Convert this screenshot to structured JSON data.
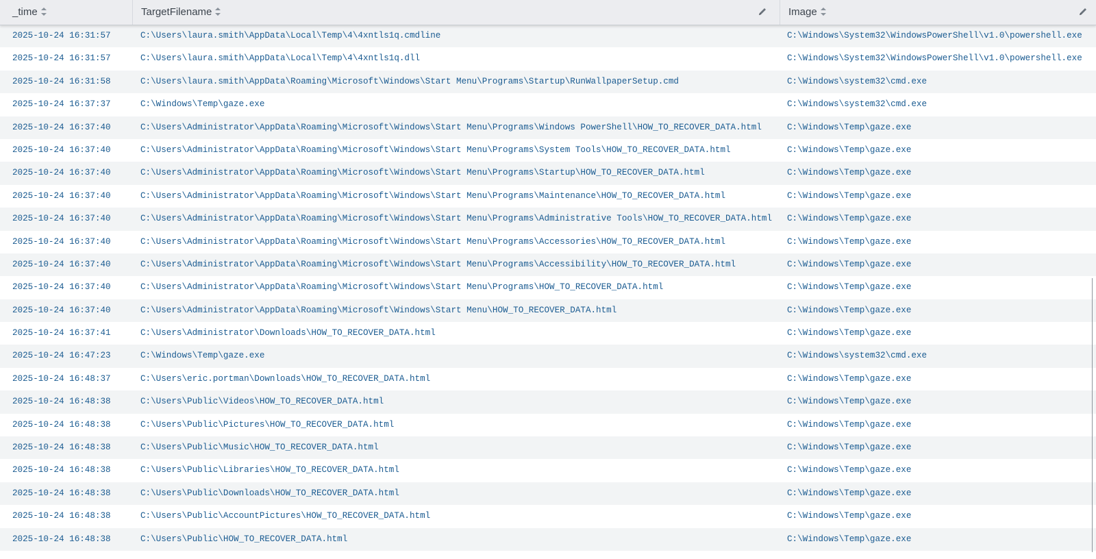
{
  "table": {
    "columns": {
      "time": "_time",
      "target": "TargetFilename",
      "image": "Image"
    },
    "rows": [
      {
        "time": "2025-10-24 16:31:57",
        "target": "C:\\Users\\laura.smith\\AppData\\Local\\Temp\\4\\4xntls1q.cmdline",
        "image": "C:\\Windows\\System32\\WindowsPowerShell\\v1.0\\powershell.exe"
      },
      {
        "time": "2025-10-24 16:31:57",
        "target": "C:\\Users\\laura.smith\\AppData\\Local\\Temp\\4\\4xntls1q.dll",
        "image": "C:\\Windows\\System32\\WindowsPowerShell\\v1.0\\powershell.exe"
      },
      {
        "time": "2025-10-24 16:31:58",
        "target": "C:\\Users\\laura.smith\\AppData\\Roaming\\Microsoft\\Windows\\Start Menu\\Programs\\Startup\\RunWallpaperSetup.cmd",
        "image": "C:\\Windows\\system32\\cmd.exe"
      },
      {
        "time": "2025-10-24 16:37:37",
        "target": "C:\\Windows\\Temp\\gaze.exe",
        "image": "C:\\Windows\\system32\\cmd.exe"
      },
      {
        "time": "2025-10-24 16:37:40",
        "target": "C:\\Users\\Administrator\\AppData\\Roaming\\Microsoft\\Windows\\Start Menu\\Programs\\Windows PowerShell\\HOW_TO_RECOVER_DATA.html",
        "image": "C:\\Windows\\Temp\\gaze.exe"
      },
      {
        "time": "2025-10-24 16:37:40",
        "target": "C:\\Users\\Administrator\\AppData\\Roaming\\Microsoft\\Windows\\Start Menu\\Programs\\System Tools\\HOW_TO_RECOVER_DATA.html",
        "image": "C:\\Windows\\Temp\\gaze.exe"
      },
      {
        "time": "2025-10-24 16:37:40",
        "target": "C:\\Users\\Administrator\\AppData\\Roaming\\Microsoft\\Windows\\Start Menu\\Programs\\Startup\\HOW_TO_RECOVER_DATA.html",
        "image": "C:\\Windows\\Temp\\gaze.exe"
      },
      {
        "time": "2025-10-24 16:37:40",
        "target": "C:\\Users\\Administrator\\AppData\\Roaming\\Microsoft\\Windows\\Start Menu\\Programs\\Maintenance\\HOW_TO_RECOVER_DATA.html",
        "image": "C:\\Windows\\Temp\\gaze.exe"
      },
      {
        "time": "2025-10-24 16:37:40",
        "target": "C:\\Users\\Administrator\\AppData\\Roaming\\Microsoft\\Windows\\Start Menu\\Programs\\Administrative Tools\\HOW_TO_RECOVER_DATA.html",
        "image": "C:\\Windows\\Temp\\gaze.exe"
      },
      {
        "time": "2025-10-24 16:37:40",
        "target": "C:\\Users\\Administrator\\AppData\\Roaming\\Microsoft\\Windows\\Start Menu\\Programs\\Accessories\\HOW_TO_RECOVER_DATA.html",
        "image": "C:\\Windows\\Temp\\gaze.exe"
      },
      {
        "time": "2025-10-24 16:37:40",
        "target": "C:\\Users\\Administrator\\AppData\\Roaming\\Microsoft\\Windows\\Start Menu\\Programs\\Accessibility\\HOW_TO_RECOVER_DATA.html",
        "image": "C:\\Windows\\Temp\\gaze.exe"
      },
      {
        "time": "2025-10-24 16:37:40",
        "target": "C:\\Users\\Administrator\\AppData\\Roaming\\Microsoft\\Windows\\Start Menu\\Programs\\HOW_TO_RECOVER_DATA.html",
        "image": "C:\\Windows\\Temp\\gaze.exe"
      },
      {
        "time": "2025-10-24 16:37:40",
        "target": "C:\\Users\\Administrator\\AppData\\Roaming\\Microsoft\\Windows\\Start Menu\\HOW_TO_RECOVER_DATA.html",
        "image": "C:\\Windows\\Temp\\gaze.exe"
      },
      {
        "time": "2025-10-24 16:37:41",
        "target": "C:\\Users\\Administrator\\Downloads\\HOW_TO_RECOVER_DATA.html",
        "image": "C:\\Windows\\Temp\\gaze.exe"
      },
      {
        "time": "2025-10-24 16:47:23",
        "target": "C:\\Windows\\Temp\\gaze.exe",
        "image": "C:\\Windows\\system32\\cmd.exe"
      },
      {
        "time": "2025-10-24 16:48:37",
        "target": "C:\\Users\\eric.portman\\Downloads\\HOW_TO_RECOVER_DATA.html",
        "image": "C:\\Windows\\Temp\\gaze.exe"
      },
      {
        "time": "2025-10-24 16:48:38",
        "target": "C:\\Users\\Public\\Videos\\HOW_TO_RECOVER_DATA.html",
        "image": "C:\\Windows\\Temp\\gaze.exe"
      },
      {
        "time": "2025-10-24 16:48:38",
        "target": "C:\\Users\\Public\\Pictures\\HOW_TO_RECOVER_DATA.html",
        "image": "C:\\Windows\\Temp\\gaze.exe"
      },
      {
        "time": "2025-10-24 16:48:38",
        "target": "C:\\Users\\Public\\Music\\HOW_TO_RECOVER_DATA.html",
        "image": "C:\\Windows\\Temp\\gaze.exe"
      },
      {
        "time": "2025-10-24 16:48:38",
        "target": "C:\\Users\\Public\\Libraries\\HOW_TO_RECOVER_DATA.html",
        "image": "C:\\Windows\\Temp\\gaze.exe"
      },
      {
        "time": "2025-10-24 16:48:38",
        "target": "C:\\Users\\Public\\Downloads\\HOW_TO_RECOVER_DATA.html",
        "image": "C:\\Windows\\Temp\\gaze.exe"
      },
      {
        "time": "2025-10-24 16:48:38",
        "target": "C:\\Users\\Public\\AccountPictures\\HOW_TO_RECOVER_DATA.html",
        "image": "C:\\Windows\\Temp\\gaze.exe"
      },
      {
        "time": "2025-10-24 16:48:38",
        "target": "C:\\Users\\Public\\HOW_TO_RECOVER_DATA.html",
        "image": "C:\\Windows\\Temp\\gaze.exe"
      }
    ]
  },
  "icons": {
    "sort": "sort-icon",
    "edit": "pencil-icon"
  },
  "colors": {
    "link": "#1a5b91",
    "header_bg": "#ecedf0",
    "row_alt": "#f2f4f5"
  }
}
